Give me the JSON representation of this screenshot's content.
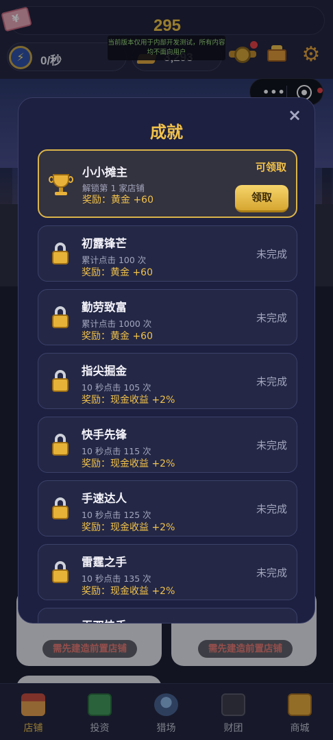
{
  "header": {
    "cash": "295",
    "income_rate": "0/秒",
    "gold": "3,293",
    "dev_notice": "当前版本仅用于内部开发测试，所有内容均不面向用户"
  },
  "icons": {
    "cash": "money-bill-icon",
    "rate": "lightning-icon",
    "gold": "gold-bar-icon",
    "medal": "medal-icon",
    "cart": "treasure-cart-icon",
    "settings": "gear-icon"
  },
  "modal": {
    "title": "成就",
    "close": "×",
    "achievements": [
      {
        "name": "小小摊主",
        "desc": "解锁第 1 家店铺",
        "reward": "奖励：黄金 +60",
        "status": "可领取",
        "button": "领取",
        "icon": "trophy-icon"
      },
      {
        "name": "初露锋芒",
        "desc": "累计点击 100 次",
        "reward": "奖励：黄金 +60",
        "status": "未完成",
        "icon": "lock-icon"
      },
      {
        "name": "勤劳致富",
        "desc": "累计点击 1000 次",
        "reward": "奖励：黄金 +60",
        "status": "未完成",
        "icon": "lock-icon"
      },
      {
        "name": "指尖掘金",
        "desc": "10 秒点击 105 次",
        "reward": "奖励：现金收益 +2%",
        "status": "未完成",
        "icon": "lock-icon"
      },
      {
        "name": "快手先锋",
        "desc": "10 秒点击 115 次",
        "reward": "奖励：现金收益 +2%",
        "status": "未完成",
        "icon": "lock-icon"
      },
      {
        "name": "手速达人",
        "desc": "10 秒点击 125 次",
        "reward": "奖励：现金收益 +2%",
        "status": "未完成",
        "icon": "lock-icon"
      },
      {
        "name": "雷霆之手",
        "desc": "10 秒点击 135 次",
        "reward": "奖励：现金收益 +2%",
        "status": "未完成",
        "icon": "lock-icon"
      },
      {
        "name": "无双快手"
      }
    ]
  },
  "shop": {
    "need_prev_left": "需先建造前置店铺",
    "need_prev_right": "需先建造前置店铺"
  },
  "bottom_nav": [
    {
      "label": "店铺",
      "icon": "shop-icon",
      "active": true
    },
    {
      "label": "投资",
      "icon": "invest-icon"
    },
    {
      "label": "猎场",
      "icon": "hunting-ground-icon"
    },
    {
      "label": "财团",
      "icon": "briefcase-icon"
    },
    {
      "label": "商城",
      "icon": "mall-cart-icon"
    }
  ],
  "colors": {
    "accent_gold": "#f2c24a",
    "modal_bg": "#1d2040",
    "warning_text": "#ee7b71"
  }
}
